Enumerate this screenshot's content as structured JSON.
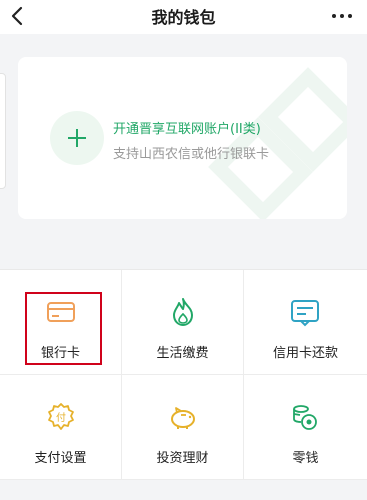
{
  "header": {
    "title": "我的钱包"
  },
  "account_card": {
    "open_account_label": "开通晋享互联网账户(II类)",
    "support_text": "支持山西农信或他行银联卡"
  },
  "services": [
    {
      "label": "银行卡",
      "icon": "bank-card-icon"
    },
    {
      "label": "生活缴费",
      "icon": "flame-icon"
    },
    {
      "label": "信用卡还款",
      "icon": "credit-card-repay-icon"
    },
    {
      "label": "支付设置",
      "icon": "payment-settings-icon"
    },
    {
      "label": "投资理财",
      "icon": "piggy-bank-icon"
    },
    {
      "label": "零钱",
      "icon": "coins-icon"
    }
  ],
  "colors": {
    "accent_green": "#21a767",
    "icon_orange": "#f0a05a",
    "icon_gold": "#e6b12a",
    "icon_teal": "#2fa3c4",
    "highlight_red": "#d0021b"
  }
}
